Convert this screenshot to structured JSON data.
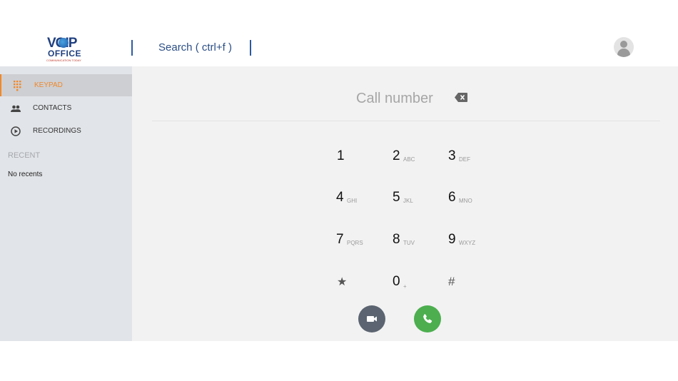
{
  "header": {
    "logo_line1": "VOIP",
    "logo_line2": "OFFICE",
    "logo_tagline": "COMMUNICATION TODAY",
    "search_label": "Search ( ctrl+f )"
  },
  "sidebar": {
    "items": [
      {
        "label": "KEYPAD",
        "icon": "keypad-icon",
        "active": true
      },
      {
        "label": "CONTACTS",
        "icon": "contacts-icon",
        "active": false
      },
      {
        "label": "RECORDINGS",
        "icon": "recordings-icon",
        "active": false
      }
    ],
    "recent_heading": "RECENT",
    "recent_empty": "No recents"
  },
  "dialer": {
    "placeholder": "Call number",
    "keys": [
      {
        "digit": "1",
        "sub": ""
      },
      {
        "digit": "2",
        "sub": "ABC"
      },
      {
        "digit": "3",
        "sub": "DEF"
      },
      {
        "digit": "4",
        "sub": "GHI"
      },
      {
        "digit": "5",
        "sub": "JKL"
      },
      {
        "digit": "6",
        "sub": "MNO"
      },
      {
        "digit": "7",
        "sub": "PQRS"
      },
      {
        "digit": "8",
        "sub": "TUV"
      },
      {
        "digit": "9",
        "sub": "WXYZ"
      },
      {
        "digit": "★",
        "sub": ""
      },
      {
        "digit": "0",
        "sub": "+"
      },
      {
        "digit": "#",
        "sub": ""
      }
    ]
  },
  "colors": {
    "accent": "#f0882a",
    "call_button": "#4cae4f",
    "video_button": "#5b6470",
    "sidebar_bg": "#e1e4e8",
    "main_bg": "#f2f2f2"
  }
}
